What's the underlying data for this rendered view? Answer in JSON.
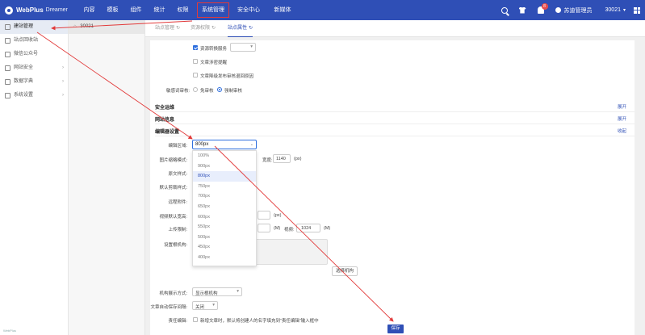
{
  "brand": {
    "name": "WebPlus",
    "sub": "Dreamer"
  },
  "nav": [
    "内容",
    "模板",
    "组件",
    "统计",
    "权限",
    "系统管理",
    "安全中心",
    "新媒体"
  ],
  "topbar": {
    "badge": "8",
    "user": "苏迪管理员",
    "site": "30021"
  },
  "sidebar": {
    "items": [
      {
        "label": "建站管理"
      },
      {
        "label": "站点回收站"
      },
      {
        "label": "微信公众号"
      },
      {
        "label": "网站安全"
      },
      {
        "label": "数据字典"
      },
      {
        "label": "系统设置"
      }
    ],
    "footer": "WebPlus"
  },
  "tree": {
    "root": "30021"
  },
  "tabs": [
    "站点管理",
    "资源权限",
    "站点属性"
  ],
  "form": {
    "opt_resource": "资源转换服务",
    "opt_article_remind": "文章涉密提醒",
    "opt_article_return": "文章降级发布审核退回原因",
    "sensitive_label": "敏感词审核:",
    "radio_free": "免审核",
    "radio_force": "强制审核",
    "sec_security": "安全运维",
    "sec_site_info": "网站信息",
    "sec_editor": "编辑器设置",
    "expand": "展开",
    "collapse": "收起",
    "editor_area_label": "编辑区域:",
    "editor_area_value": "800px",
    "image_thumb_label": "图片缩略模式:",
    "width_label": "宽度:",
    "width_value": "1140",
    "width_unit": "(px)",
    "body_style_label": "原文样式:",
    "default_cut_label": "默认剪裁样式:",
    "remote_attach_label": "远程附件:",
    "video_width_label": "视频默认宽高:",
    "video_unit": "(px)",
    "upload_limit_label": "上传限制:",
    "upload_m1": "(M)",
    "upload_video_label": "视频:",
    "upload_video_value": "1024",
    "upload_m2": "(M)",
    "org_label": "设置根机构:",
    "choose_org": "选择机构",
    "org_display_label": "机构展示方式:",
    "org_display_value": "显示根机构",
    "autosave_label": "文章自动保存间隔:",
    "autosave_value": "关闭",
    "editor_label": "责任编辑:",
    "editor_hint": "新增文章时，默认将创建人的名字填充到“责任编辑”输入框中",
    "save": "保存"
  },
  "dropdown_options": [
    "100%",
    "900px",
    "800px",
    "750px",
    "700px",
    "650px",
    "600px",
    "550px",
    "500px",
    "450px",
    "400px"
  ],
  "dropdown_selected": "800px",
  "colors": {
    "topbar": "#2f4fb6",
    "accent": "#2f6fde",
    "highlight": "#e23a3a"
  }
}
